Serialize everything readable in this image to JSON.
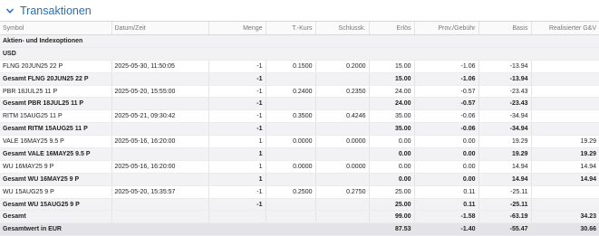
{
  "panel": {
    "title": "Transaktionen"
  },
  "columns": [
    "Symbol",
    "Datum/Zeit",
    "Menge",
    "T.-Kurs",
    "Schlussk.",
    "Erlös",
    "Prov./Gebühr",
    "Basis",
    "Realisierter G&V"
  ],
  "groups": {
    "category": "Aktien- und Indexoptionen",
    "currency": "USD"
  },
  "rows": [
    {
      "type": "detail",
      "cells": [
        "FLNG 20JUN25 22 P",
        "2025-05-30, 11:50:05",
        "-1",
        "0.1500",
        "0.2000",
        "15.00",
        "-1.06",
        "-13.94",
        ""
      ]
    },
    {
      "type": "total",
      "cells": [
        "Gesamt FLNG 20JUN25 22 P",
        "",
        "-1",
        "",
        "",
        "15.00",
        "-1.06",
        "-13.94",
        ""
      ]
    },
    {
      "type": "detail",
      "cells": [
        "PBR 18JUL25 11 P",
        "2025-05-20, 15:55:00",
        "-1",
        "0.2400",
        "0.2350",
        "24.00",
        "-0.57",
        "-23.43",
        ""
      ]
    },
    {
      "type": "total",
      "cells": [
        "Gesamt PBR 18JUL25 11 P",
        "",
        "-1",
        "",
        "",
        "24.00",
        "-0.57",
        "-23.43",
        ""
      ]
    },
    {
      "type": "detail",
      "cells": [
        "RITM 15AUG25 11 P",
        "2025-05-21, 09:30:42",
        "-1",
        "0.3500",
        "0.4246",
        "35.00",
        "-0.06",
        "-34.94",
        ""
      ]
    },
    {
      "type": "total",
      "cells": [
        "Gesamt RITM 15AUG25 11 P",
        "",
        "-1",
        "",
        "",
        "35.00",
        "-0.06",
        "-34.94",
        ""
      ]
    },
    {
      "type": "detail",
      "cells": [
        "VALE 16MAY25 9.5 P",
        "2025-05-16, 16:20:00",
        "1",
        "0.0000",
        "0.0000",
        "0.00",
        "0.00",
        "19.29",
        "19.29"
      ]
    },
    {
      "type": "total",
      "cells": [
        "Gesamt VALE 16MAY25 9.5 P",
        "",
        "1",
        "",
        "",
        "0.00",
        "0.00",
        "19.29",
        "19.29"
      ]
    },
    {
      "type": "detail",
      "cells": [
        "WU 16MAY25 9 P",
        "2025-05-16, 16:20:00",
        "1",
        "0.0000",
        "0.0000",
        "0.00",
        "0.00",
        "14.94",
        "14.94"
      ]
    },
    {
      "type": "total",
      "cells": [
        "Gesamt WU 16MAY25 9 P",
        "",
        "1",
        "",
        "",
        "0.00",
        "0.00",
        "14.94",
        "14.94"
      ]
    },
    {
      "type": "detail",
      "cells": [
        "WU 15AUG25 9 P",
        "2025-05-20, 15:35:57",
        "-1",
        "0.2500",
        "0.2750",
        "25.00",
        "0.11",
        "-25.11",
        ""
      ]
    },
    {
      "type": "total",
      "cells": [
        "Gesamt WU 15AUG25 9 P",
        "",
        "-1",
        "",
        "",
        "25.00",
        "0.11",
        "-25.11",
        ""
      ]
    },
    {
      "type": "grand",
      "cells": [
        "Gesamt",
        "",
        "",
        "",
        "",
        "99.00",
        "-1.58",
        "-63.19",
        "34.23"
      ]
    },
    {
      "type": "eur",
      "cells": [
        "Gesamtwert in EUR",
        "",
        "",
        "",
        "",
        "87.53",
        "-1.40",
        "-55.47",
        "30.66"
      ]
    }
  ]
}
